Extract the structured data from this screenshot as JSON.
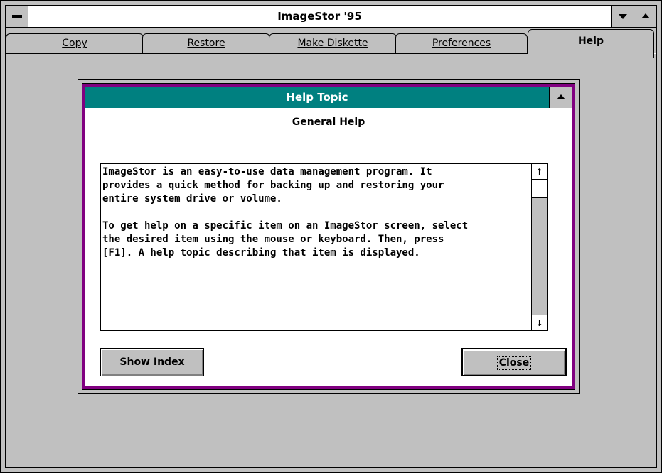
{
  "window": {
    "title": "ImageStor '95"
  },
  "tabs": [
    {
      "label": "Copy",
      "active": false
    },
    {
      "label": "Restore",
      "active": false
    },
    {
      "label": "Make Diskette",
      "active": false
    },
    {
      "label": "Preferences",
      "active": false
    },
    {
      "label": "Help",
      "active": true
    }
  ],
  "help_dialog": {
    "title": "Help Topic",
    "subtitle": "General Help",
    "body": "ImageStor is an easy-to-use data management program. It\nprovides a quick method for backing up and restoring your\nentire system drive or volume.\n\nTo get help on a specific item on an ImageStor screen, select\nthe desired item using the mouse or keyboard. Then, press\n[F1]. A help topic describing that item is displayed.",
    "show_index_label": "Show Index",
    "close_label": "Close"
  },
  "colors": {
    "title_bar": "#008080",
    "dialog_border": "#800080",
    "chrome": "#c0c0c0"
  }
}
